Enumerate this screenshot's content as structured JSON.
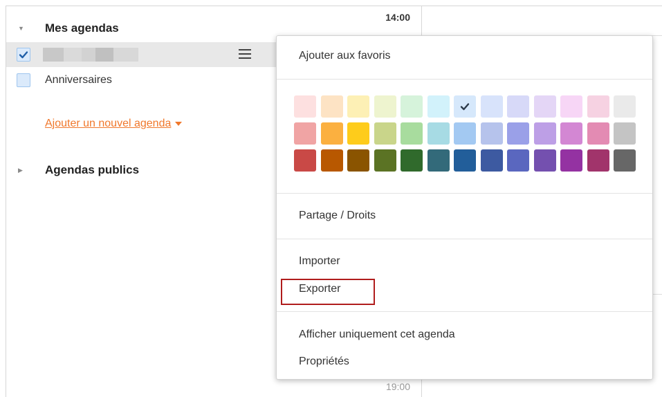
{
  "sidebar": {
    "my_calendars": {
      "title": "Mes agendas",
      "caret_icon": "caret-down-icon"
    },
    "calendars": [
      {
        "label": "",
        "checked": true,
        "blurred": true
      },
      {
        "label": "Anniversaires",
        "checked": false
      }
    ],
    "add_calendar_link": "Ajouter un nouvel agenda",
    "public_calendars": {
      "title": "Agendas publics",
      "caret_icon": "caret-right-icon"
    }
  },
  "grid": {
    "time_top": "14:00",
    "time_bottom": "19:00"
  },
  "context_menu": {
    "add_favorites": "Ajouter aux favoris",
    "colors": [
      "#fde0e0",
      "#fde3c4",
      "#fdf0b5",
      "#eef4cf",
      "#d6f3db",
      "#d2f2fb",
      "#d6e8fb",
      "#d8e3fb",
      "#d7d9f8",
      "#e4d6f6",
      "#f7d6f6",
      "#f6d2e2",
      "#eaeaea",
      "#f0a4a4",
      "#fbb040",
      "#fecc1b",
      "#c9d58a",
      "#a8dc9e",
      "#a7dbe4",
      "#a3c9f2",
      "#b6c3ec",
      "#9aa0e8",
      "#bd9fe6",
      "#d387d3",
      "#e38bb3",
      "#c4c4c4",
      "#c94946",
      "#b85800",
      "#8a5400",
      "#5b7324",
      "#306a2c",
      "#336a7a",
      "#225e9a",
      "#3d5aa1",
      "#5a67bf",
      "#7450af",
      "#9432a2",
      "#a1346b",
      "#676767"
    ],
    "selected_color_index": 6,
    "sharing": "Partage / Droits",
    "import": "Importer",
    "export": "Exporter",
    "show_only": "Afficher uniquement cet agenda",
    "properties": "Propriétés"
  },
  "colors": {
    "accent_link": "#f0782c",
    "highlight": "#b01c1c"
  }
}
